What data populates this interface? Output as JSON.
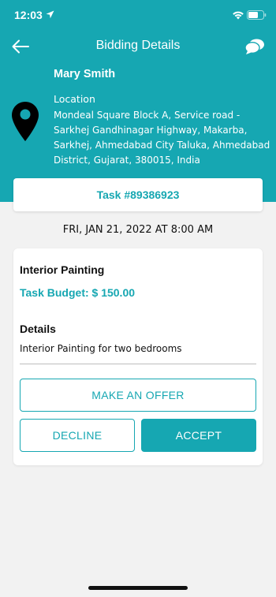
{
  "status_bar": {
    "time": "12:03",
    "icons": [
      "location-arrow-icon",
      "wifi-icon",
      "battery-icon"
    ]
  },
  "nav": {
    "title": "Bidding Details",
    "back_icon": "back-arrow-icon",
    "chat_icon": "chat-bubbles-icon"
  },
  "customer": {
    "name": "Mary Smith",
    "location_label": "Location",
    "address": "Mondeal Square Block A, Service road - Sarkhej Gandhinagar Highway, Makarba, Sarkhej, Ahmedabad City Taluka, Ahmedabad District, Gujarat, 380015, India",
    "pin_icon": "map-pin-icon"
  },
  "task": {
    "number_label": "Task #89386923",
    "datetime": "FRI, JAN 21, 2022 AT 8:00 AM",
    "title": "Interior Painting",
    "budget_label": "Task Budget: $ 150.00",
    "details_heading": "Details",
    "details_text": "Interior Painting for two bedrooms"
  },
  "actions": {
    "make_offer": "MAKE AN OFFER",
    "decline": "DECLINE",
    "accept": "ACCEPT"
  },
  "colors": {
    "accent": "#16a7b2",
    "background": "#f2f2f2",
    "card": "#ffffff"
  }
}
